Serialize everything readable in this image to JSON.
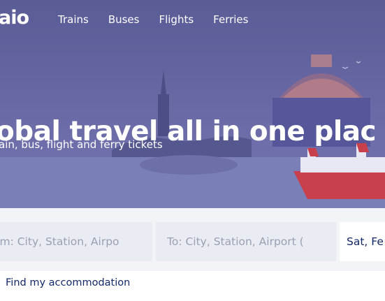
{
  "header": {
    "logo_text": "aio",
    "nav": [
      {
        "label": "Trains"
      },
      {
        "label": "Buses"
      },
      {
        "label": "Flights"
      },
      {
        "label": "Ferries"
      }
    ]
  },
  "hero": {
    "headline": "obal travel all in one plac",
    "subline": "ain, bus, flight and ferry tickets"
  },
  "search": {
    "from_placeholder": "om: City, Station, Airpo",
    "to_placeholder": "To: City, Station, Airport (",
    "date_value": "Sat, Fe"
  },
  "links": {
    "accommodation": "Find my accommodation"
  },
  "colors": {
    "hero_bg": "#5f619c",
    "text_dark": "#132968",
    "placeholder": "#9aa0b3",
    "field_bg": "#e9ecf3"
  }
}
